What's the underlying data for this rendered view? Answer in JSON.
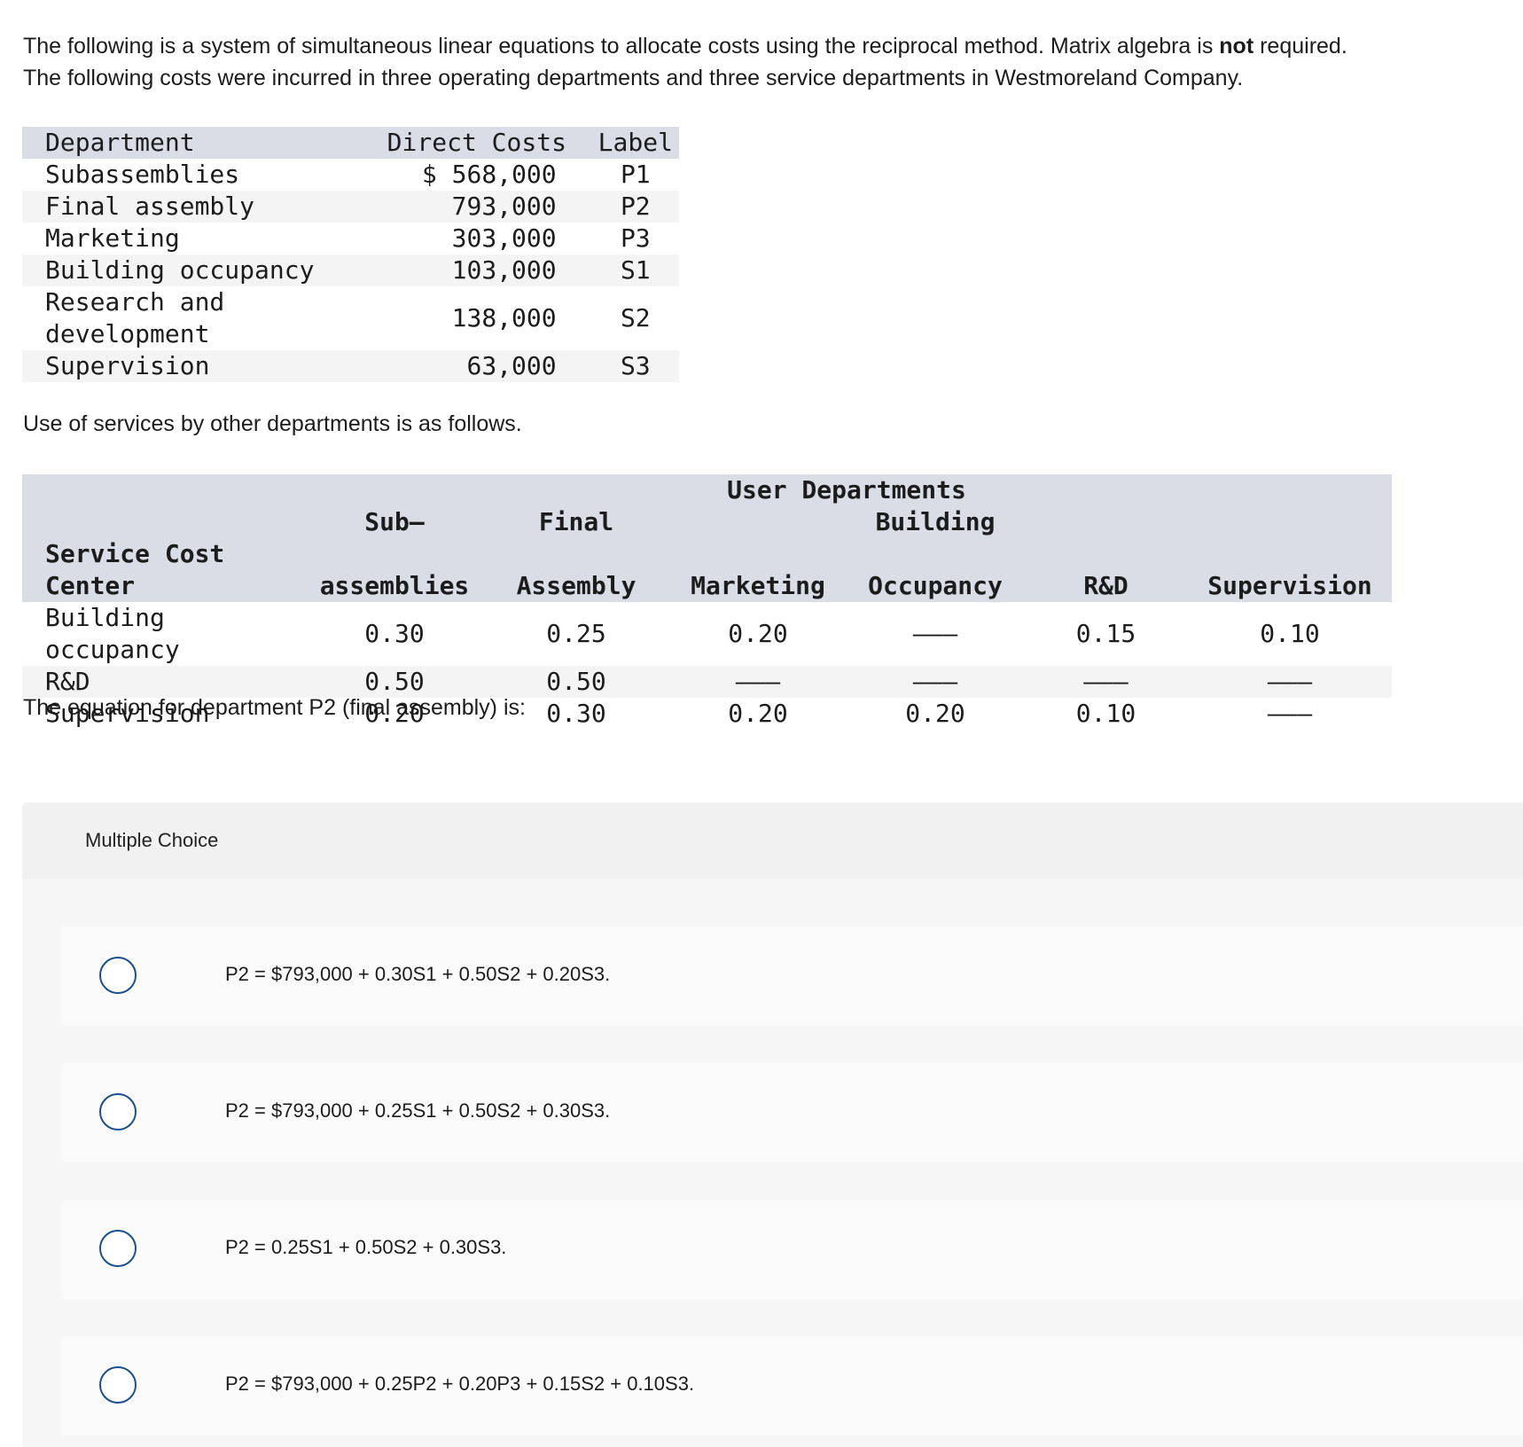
{
  "intro": {
    "line1_pre": "The following is a system of simultaneous linear equations to allocate costs using the reciprocal method. Matrix algebra is ",
    "line1_bold": "not",
    "line1_post": " required.",
    "line2": "The following costs were incurred in three operating departments and three service departments in Westmoreland Company."
  },
  "cost_table": {
    "headers": {
      "department": "Department",
      "direct_costs": "Direct Costs",
      "label": "Label"
    },
    "rows": [
      {
        "department": "Subassemblies",
        "cost": "$ 568,000",
        "label": "P1"
      },
      {
        "department": "Final assembly",
        "cost": "793,000",
        "label": "P2"
      },
      {
        "department": "Marketing",
        "cost": "303,000",
        "label": "P3"
      },
      {
        "department": "Building occupancy",
        "cost": "103,000",
        "label": "S1"
      },
      {
        "department_line1": "Research and",
        "department_line2": "development",
        "cost": "138,000",
        "label": "S2"
      },
      {
        "department": "Supervision",
        "cost": "63,000",
        "label": "S3"
      }
    ]
  },
  "usage_intro": "Use of services by other departments is as follows.",
  "usage_table": {
    "group_header": "User Departments",
    "headers": {
      "service_cost_center": "Service Cost Center",
      "subassemblies_1": "Sub–",
      "subassemblies_2": "assemblies",
      "final_1": "Final",
      "final_2": "Assembly",
      "marketing": "Marketing",
      "building_1": "Building",
      "building_2": "Occupancy",
      "rd": "R&D",
      "supervision": "Supervision"
    },
    "rows": [
      {
        "center": "Building occupancy",
        "sub": "0.30",
        "final": "0.25",
        "marketing": "0.20",
        "building": "———",
        "rd": "0.15",
        "supervision": "0.10"
      },
      {
        "center": "R&D",
        "sub": "0.50",
        "final": "0.50",
        "marketing": "———",
        "building": "———",
        "rd": "———",
        "supervision": "———"
      },
      {
        "center": "Supervision",
        "sub": "0.20",
        "final": "0.30",
        "marketing": "0.20",
        "building": "0.20",
        "rd": "0.10",
        "supervision": "———"
      }
    ]
  },
  "question": "The equation for department P2 (final assembly) is:",
  "multiple_choice": {
    "label": "Multiple Choice",
    "options": [
      "P2 = $793,000 + 0.30S1 + 0.50S2 + 0.20S3.",
      "P2 = $793,000 + 0.25S1 + 0.50S2 + 0.30S3.",
      "P2 = 0.25S1 + 0.50S2 + 0.30S3.",
      "P2 = $793,000 + 0.25P2 + 0.20P3 + 0.15S2 + 0.10S3."
    ]
  },
  "colors": {
    "header_band": "#d8dde6",
    "row_stripe": "#f4f4f4",
    "radio_border": "#1c4f8a",
    "mc_header_bg": "#f1f1f1",
    "mc_body_bg": "#f6f6f6"
  }
}
